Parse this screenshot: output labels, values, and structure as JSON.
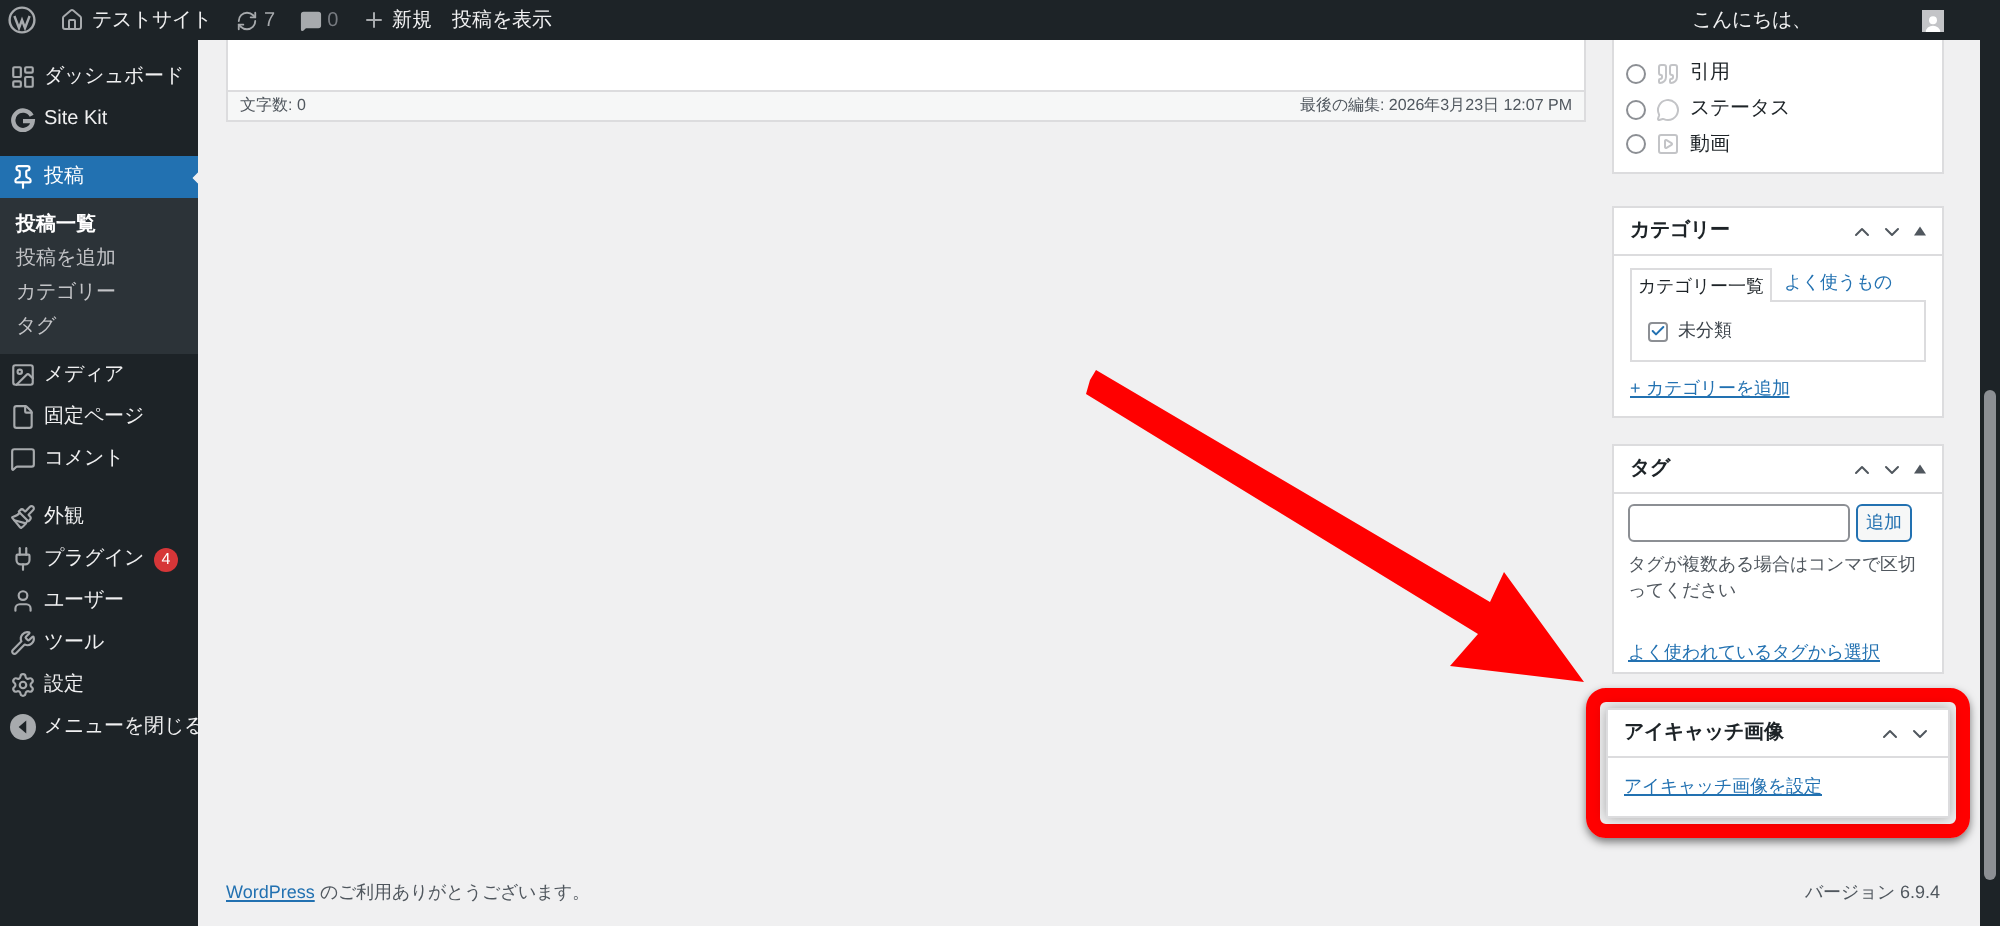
{
  "admin_bar": {
    "site_name": "テストサイト",
    "updates_count": "7",
    "comments_count": "0",
    "new_label": "新規",
    "view_post": "投稿を表示",
    "greeting": "こんにちは、"
  },
  "sidebar": {
    "items": [
      {
        "label": "ダッシュボード",
        "selected": false
      },
      {
        "label": "Site Kit",
        "selected": false
      },
      {
        "label": "投稿",
        "selected": true,
        "children": [
          {
            "label": "投稿一覧",
            "selected": true
          },
          {
            "label": "投稿を追加",
            "selected": false
          },
          {
            "label": "カテゴリー",
            "selected": false
          },
          {
            "label": "タグ",
            "selected": false
          }
        ]
      },
      {
        "label": "メディア",
        "selected": false
      },
      {
        "label": "固定ページ",
        "selected": false
      },
      {
        "label": "コメント",
        "selected": false
      },
      {
        "label": "外観",
        "selected": false
      },
      {
        "label": "プラグイン",
        "selected": false,
        "badge": "4"
      },
      {
        "label": "ユーザー",
        "selected": false
      },
      {
        "label": "ツール",
        "selected": false
      },
      {
        "label": "設定",
        "selected": false
      },
      {
        "label": "メニューを閉じる",
        "selected": false
      }
    ]
  },
  "editor": {
    "word_count": "文字数: 0",
    "last_edited": "最後の編集: 2026年3月23日 12:07 PM"
  },
  "format_box": {
    "options": [
      {
        "label": "引用",
        "selected": false
      },
      {
        "label": "ステータス",
        "selected": false
      },
      {
        "label": "動画",
        "selected": false
      }
    ]
  },
  "category_box": {
    "title": "カテゴリー",
    "tabs": [
      {
        "label": "カテゴリー一覧",
        "selected": true
      },
      {
        "label": "よく使うもの",
        "selected": false
      }
    ],
    "categories": [
      {
        "label": "未分類",
        "checked": true
      }
    ],
    "add_link": "+ カテゴリーを追加"
  },
  "tag_box": {
    "title": "タグ",
    "add_button": "追加",
    "hint": "タグが複数ある場合はコンマで区切ってください",
    "choose_link": "よく使われているタグから選択"
  },
  "featured_image_box": {
    "title": "アイキャッチ画像",
    "set_link": "アイキャッチ画像を設定"
  },
  "footer": {
    "link": "WordPress",
    "thanks": "のご利用ありがとうございます。",
    "version": "バージョン 6.9.4"
  }
}
